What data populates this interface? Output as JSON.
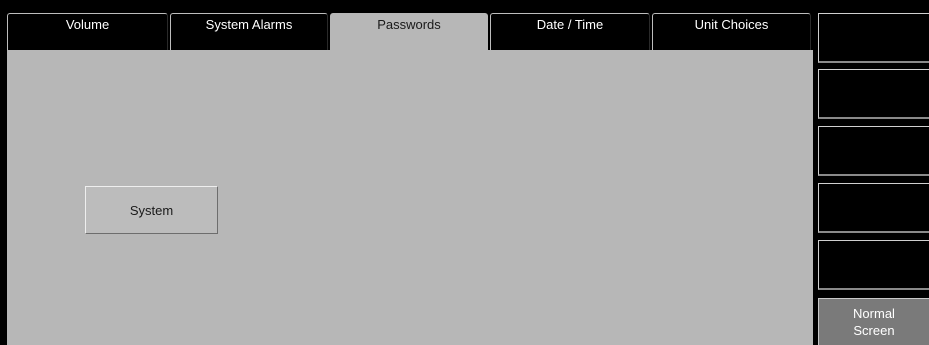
{
  "tabs": [
    {
      "label": "Volume",
      "active": false
    },
    {
      "label": "System Alarms",
      "active": false
    },
    {
      "label": "Passwords",
      "active": true
    },
    {
      "label": "Date / Time",
      "active": false
    },
    {
      "label": "Unit Choices",
      "active": false
    }
  ],
  "main": {
    "system_button_label": "System"
  },
  "softkeys": {
    "normal_screen_line1": "Normal",
    "normal_screen_line2": "Screen"
  },
  "colors": {
    "panel": "#b7b7b7",
    "background": "#000000",
    "softkey_normal": "#7a7a7a"
  }
}
